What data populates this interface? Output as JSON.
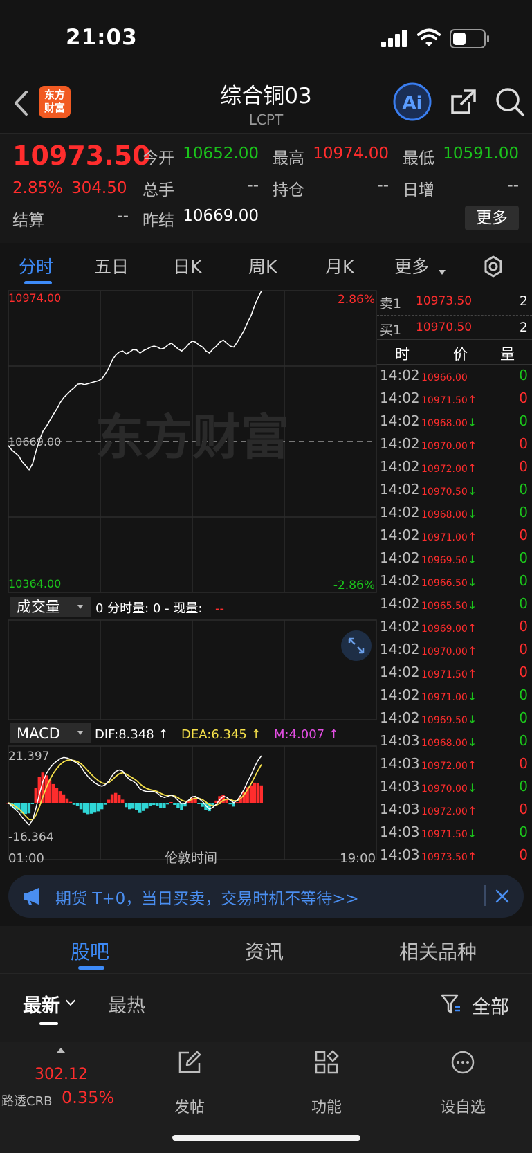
{
  "status_bar": {
    "time": "21:03"
  },
  "header": {
    "logo_line1": "东方",
    "logo_line2": "财富",
    "title": "综合铜03",
    "subtitle": "LCPT"
  },
  "quote": {
    "price": "10973.50",
    "change_pct": "2.85%",
    "change": "304.50",
    "open_label": "今开",
    "open": "10652.00",
    "high_label": "最高",
    "high": "10974.00",
    "low_label": "最低",
    "low": "10591.00",
    "volume_label": "总手",
    "volume": "--",
    "oi_label": "持仓",
    "oi": "--",
    "daily_inc_label": "日增",
    "daily_inc": "--",
    "settle_label": "结算",
    "settle": "--",
    "prev_settle_label": "昨结",
    "prev_settle": "10669.00",
    "more_label": "更多"
  },
  "period_tabs": [
    "分时",
    "五日",
    "日K",
    "周K",
    "月K",
    "更多"
  ],
  "chart": {
    "price_top": "10974.00",
    "price_mid": "10669.00",
    "price_bottom": "10364.00",
    "pct_top": "2.86%",
    "pct_bottom": "-2.86%",
    "watermark": "东方财富",
    "volume_selector": "成交量",
    "volume_info_prefix": "0 分时量: 0 - 现量:",
    "volume_info_value": "--",
    "macd_selector": "MACD",
    "dif": "DIF:8.348 ↑",
    "dea": "DEA:6.345 ↑",
    "m": "M:4.007 ↑",
    "macd_top": "21.397",
    "macd_bottom": "-16.364",
    "time_start": "01:00",
    "time_mid": "伦敦时间",
    "time_end": "19:00",
    "colors": {
      "up": "#ff2d2d",
      "down": "#1bc51b",
      "dif": "#ffffff",
      "dea": "#f5e04a",
      "m": "#e34ee3",
      "macd_neg": "#2fd6d6"
    }
  },
  "chart_data": {
    "type": "line",
    "title": "",
    "xlabel": "伦敦时间",
    "ylabel": "",
    "ylim": [
      10364.0,
      10974.0
    ],
    "reference": 10669.0,
    "x_range": [
      "01:00",
      "19:00"
    ],
    "grid": true,
    "series": [
      {
        "values": [
          10661,
          10652,
          10646,
          10640,
          10628,
          10620,
          10612,
          10624,
          10650,
          10672,
          10690,
          10700,
          10712,
          10724,
          10735,
          10748,
          10758,
          10765,
          10772,
          10778,
          10785,
          10786,
          10784,
          10786,
          10788,
          10790,
          10792,
          10796,
          10806,
          10818,
          10834,
          10844,
          10850,
          10852,
          10846,
          10850,
          10855,
          10854,
          10848,
          10853,
          10856,
          10860,
          10862,
          10860,
          10856,
          10858,
          10864,
          10868,
          10862,
          10856,
          10852,
          10858,
          10866,
          10872,
          10870,
          10864,
          10860,
          10852,
          10848,
          10856,
          10862,
          10870,
          10874,
          10868,
          10862,
          10860,
          10870,
          10882,
          10894,
          10910,
          10924,
          10944,
          10960,
          10973.5
        ]
      }
    ]
  },
  "order_book": {
    "sell_label": "卖1",
    "sell_price": "10973.50",
    "sell_qty": "2",
    "buy_label": "买1",
    "buy_price": "10970.50",
    "buy_qty": "2",
    "col_time": "时",
    "col_price": "价",
    "col_qty": "量"
  },
  "ticks": [
    {
      "t": "14:02",
      "p": "10966.00",
      "a": "",
      "v": "0",
      "vc": "green"
    },
    {
      "t": "14:02",
      "p": "10971.50",
      "a": "↑",
      "v": "0",
      "vc": "red"
    },
    {
      "t": "14:02",
      "p": "10968.00",
      "a": "↓",
      "v": "0",
      "vc": "green"
    },
    {
      "t": "14:02",
      "p": "10970.00",
      "a": "↑",
      "v": "0",
      "vc": "red"
    },
    {
      "t": "14:02",
      "p": "10972.00",
      "a": "↑",
      "v": "0",
      "vc": "red"
    },
    {
      "t": "14:02",
      "p": "10970.50",
      "a": "↓",
      "v": "0",
      "vc": "green"
    },
    {
      "t": "14:02",
      "p": "10968.00",
      "a": "↓",
      "v": "0",
      "vc": "green"
    },
    {
      "t": "14:02",
      "p": "10971.00",
      "a": "↑",
      "v": "0",
      "vc": "red"
    },
    {
      "t": "14:02",
      "p": "10969.50",
      "a": "↓",
      "v": "0",
      "vc": "green"
    },
    {
      "t": "14:02",
      "p": "10966.50",
      "a": "↓",
      "v": "0",
      "vc": "green"
    },
    {
      "t": "14:02",
      "p": "10965.50",
      "a": "↓",
      "v": "0",
      "vc": "green"
    },
    {
      "t": "14:02",
      "p": "10969.00",
      "a": "↑",
      "v": "0",
      "vc": "red"
    },
    {
      "t": "14:02",
      "p": "10970.00",
      "a": "↑",
      "v": "0",
      "vc": "red"
    },
    {
      "t": "14:02",
      "p": "10971.50",
      "a": "↑",
      "v": "0",
      "vc": "red"
    },
    {
      "t": "14:02",
      "p": "10971.00",
      "a": "↓",
      "v": "0",
      "vc": "green"
    },
    {
      "t": "14:02",
      "p": "10969.50",
      "a": "↓",
      "v": "0",
      "vc": "green"
    },
    {
      "t": "14:03",
      "p": "10968.00",
      "a": "↓",
      "v": "0",
      "vc": "green"
    },
    {
      "t": "14:03",
      "p": "10972.00",
      "a": "↑",
      "v": "0",
      "vc": "red"
    },
    {
      "t": "14:03",
      "p": "10970.00",
      "a": "↓",
      "v": "0",
      "vc": "green"
    },
    {
      "t": "14:03",
      "p": "10972.00",
      "a": "↑",
      "v": "0",
      "vc": "red"
    },
    {
      "t": "14:03",
      "p": "10971.50",
      "a": "↓",
      "v": "0",
      "vc": "green"
    },
    {
      "t": "14:03",
      "p": "10973.50",
      "a": "↑",
      "v": "0",
      "vc": "red"
    }
  ],
  "banner": {
    "text": "期货 T+0，当日买卖，交易时机不等待>>"
  },
  "bottom_tabs": [
    "股吧",
    "资讯",
    "相关品种"
  ],
  "sub_tabs": {
    "latest": "最新",
    "hot": "最热",
    "filter_all": "全部"
  },
  "toolbar": {
    "index_value": "302.12",
    "index_name": "路透CRB",
    "index_pct": "0.35%",
    "post": "发帖",
    "function": "功能",
    "watchlist": "设自选"
  }
}
